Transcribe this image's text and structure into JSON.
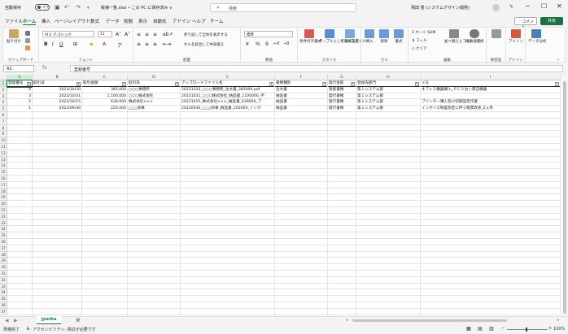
{
  "titlebar": {
    "autosave_label": "自動保存",
    "autosave_state": "オフ",
    "file_title": "帳簿一覧.xlsx • この PC に保存済み ∨",
    "search_placeholder": "検索",
    "user_name": "飛田 晋 (システムデザイン開発)"
  },
  "tabs": [
    "ファイル",
    "ホーム",
    "挿入",
    "ページレイアウト",
    "数式",
    "データ",
    "校閲",
    "表示",
    "自動化",
    "アドイン",
    "ヘルプ",
    "チーム"
  ],
  "active_tab": "ホーム",
  "header_buttons": {
    "comment": "コメント",
    "share": "共有"
  },
  "ribbon": {
    "clipboard": {
      "paste": "貼り付け",
      "label": "クリップボード"
    },
    "font": {
      "name": "ＭＳ Ｐゴシック",
      "size": "11",
      "label": "フォント"
    },
    "alignment": {
      "wrap": "折り返して全体を表示する",
      "merge": "セルを結合して中央揃え",
      "label": "配置"
    },
    "number": {
      "format": "標準",
      "label": "数値"
    },
    "styles": {
      "conditional": "条件付き書式",
      "table": "テーブルとして書式設定",
      "cell": "セルのスタイル",
      "label": "スタイル"
    },
    "cells": {
      "insert": "挿入",
      "delete": "削除",
      "format": "書式",
      "label": "セル"
    },
    "editing": {
      "autosum": "オート SUM",
      "fill": "フィル",
      "clear": "クリア",
      "sort": "並べ替えとフィルター",
      "find": "検索と選択",
      "label": "編集"
    },
    "sensitivity": {
      "btn": "秘密度",
      "label": "秘密度"
    },
    "addins": {
      "btn": "アドイン",
      "label": "アドイン"
    },
    "analyze": {
      "btn": "データ分析"
    }
  },
  "formula_bar": {
    "name_box": "A1",
    "fx": "fx",
    "content": "登録番号"
  },
  "columns": [
    "A",
    "B",
    "C",
    "D",
    "E",
    "F",
    "G",
    "H",
    "I"
  ],
  "row_numbers": [
    "1",
    "2",
    "3",
    "4",
    "5",
    "6",
    "7",
    "8",
    "9",
    "10",
    "11",
    "12",
    "13",
    "14",
    "15",
    "16",
    "17",
    "18",
    "19",
    "20",
    "21",
    "22",
    "23",
    "24",
    "25",
    "26",
    "27",
    "28",
    "29",
    "30",
    "31",
    "32",
    "33",
    "34",
    "35",
    "36",
    "37"
  ],
  "table": {
    "headers": [
      "登録番号",
      "取引日",
      "取引金額",
      "取引先",
      "アップロードファイル名",
      "書類種別",
      "発行受取",
      "登録先部門",
      "メモ"
    ],
    "rows": [
      [
        "4",
        "2023/10/20",
        "385,000",
        "○○○事務所",
        "20231020_○○○事務所_注文書_385000.pdf",
        "注文書",
        "受取書類",
        "第１システム部",
        "オフィス機器購入_ＰＣ５台＋周辺機器"
      ],
      [
        "3",
        "2023/10/31",
        "1,100,000",
        "○○○株式会社",
        "20231031_○○○株式会社_納品書_1100000_不",
        "納品書",
        "発行書類",
        "第１システム部",
        ""
      ],
      [
        "2",
        "2023/10/15",
        "638,000",
        "株式会社×××",
        "20231015_株式会社×××_納品書_638000_ブ",
        "納品書",
        "発行書類",
        "第１システム部",
        "プリンター購入及び初期設定作業"
      ],
      [
        "1",
        "2023/09/30",
        "220,000",
        "△△△商事",
        "20230930_△△△商事_納品書_220000_インボ",
        "納品書",
        "発行書類",
        "第１システム部",
        "インボイス制度改定に伴う帳票改修_2ヵ月"
      ]
    ]
  },
  "sheet_tab": "jyuchu",
  "status": {
    "ready": "準備完了",
    "accessibility": "アクセシビリティ: 検討が必要です",
    "zoom": "100%"
  }
}
